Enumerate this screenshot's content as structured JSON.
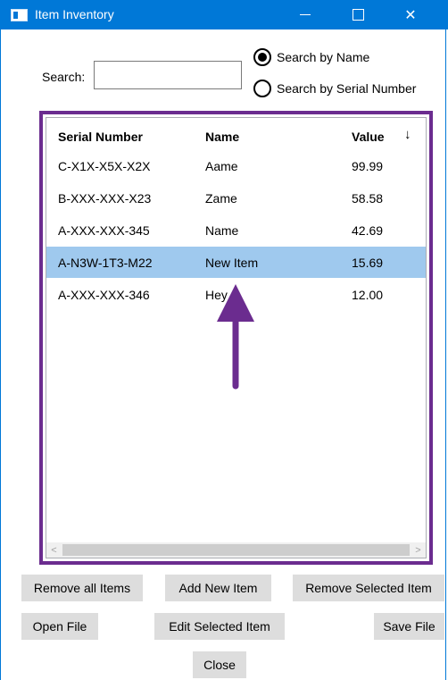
{
  "window": {
    "title": "Item Inventory",
    "controls": {
      "minimize": "minimize",
      "maximize": "maximize",
      "close": "✕"
    }
  },
  "search": {
    "label": "Search:",
    "value": "",
    "placeholder": ""
  },
  "search_mode": {
    "options": [
      {
        "label": "Search by Name",
        "selected": true
      },
      {
        "label": "Search by Serial Number",
        "selected": false
      }
    ]
  },
  "list": {
    "columns": {
      "serial": "Serial Number",
      "name": "Name",
      "value": "Value",
      "sort_indicator": "↓"
    },
    "rows": [
      {
        "serial": "C-X1X-X5X-X2X",
        "name": "Aame",
        "value": "99.99",
        "selected": false
      },
      {
        "serial": "B-XXX-XXX-X23",
        "name": "Zame",
        "value": "58.58",
        "selected": false
      },
      {
        "serial": "A-XXX-XXX-345",
        "name": "Name",
        "value": "42.69",
        "selected": false
      },
      {
        "serial": "A-N3W-1T3-M22",
        "name": "New Item",
        "value": "15.69",
        "selected": true
      },
      {
        "serial": "A-XXX-XXX-346",
        "name": "Hey",
        "value": "12.00",
        "selected": false
      }
    ]
  },
  "buttons": {
    "remove_all": "Remove all Items",
    "add_new": "Add New Item",
    "remove_selected": "Remove Selected Item",
    "open_file": "Open File",
    "edit_selected": "Edit Selected Item",
    "save_file": "Save File",
    "close": "Close"
  },
  "colors": {
    "titlebar": "#0078d7",
    "selection": "#9fc9ee",
    "highlight_border": "#6b2c8f",
    "annotation_arrow": "#6b2c8f"
  },
  "icons": {
    "app": "window-app-icon",
    "sort": "arrow-down-icon",
    "annotation": "arrow-up-icon"
  }
}
